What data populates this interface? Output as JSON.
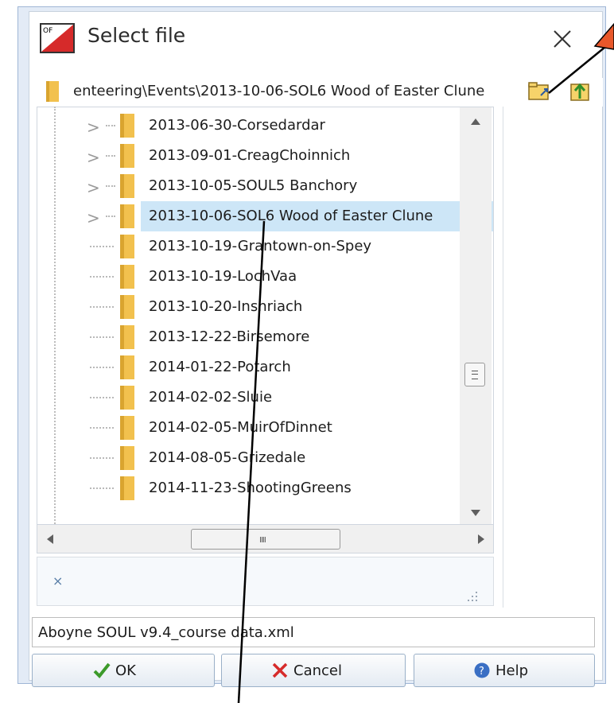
{
  "dialog": {
    "title": "Select file",
    "close_glyph": "✕"
  },
  "pathbar": {
    "path": "enteering\\Events\\2013-10-06-SOL6 Wood of Easter Clune",
    "browse_icon": "open-folder-icon",
    "up_icon": "up-folder-icon"
  },
  "tree": {
    "items": [
      {
        "label": "2013-06-30-Corsedardar",
        "expandable": true
      },
      {
        "label": "2013-09-01-CreagChoinnich",
        "expandable": true
      },
      {
        "label": "2013-10-05-SOUL5 Banchory",
        "expandable": true
      },
      {
        "label": "2013-10-06-SOL6 Wood of Easter Clune",
        "expandable": true,
        "selected": true
      },
      {
        "label": "2013-10-19-Grantown-on-Spey",
        "expandable": false
      },
      {
        "label": "2013-10-19-LochVaa",
        "expandable": false
      },
      {
        "label": "2013-10-20-Inshriach",
        "expandable": false
      },
      {
        "label": "2013-12-22-Birsemore",
        "expandable": false
      },
      {
        "label": "2014-01-22-Potarch",
        "expandable": false
      },
      {
        "label": "2014-02-02-Sluie",
        "expandable": false
      },
      {
        "label": "2014-02-05-MuirOfDinnet",
        "expandable": false
      },
      {
        "label": "2014-08-05-Grizedale",
        "expandable": false
      },
      {
        "label": "2014-11-23-ShootingGreens",
        "expandable": false
      }
    ]
  },
  "scrollbars": {
    "hthumb_grip": "IIII"
  },
  "filter": {
    "clear_glyph": "×"
  },
  "filename": {
    "value": "Aboyne SOUL v9.4_course data.xml"
  },
  "buttons": {
    "ok": "OK",
    "cancel": "Cancel",
    "help": "Help"
  },
  "colors": {
    "selection": "#cde6f7",
    "folder": "#f2c14e",
    "ok_check": "#3c9a2a",
    "cancel_x": "#d62b2b",
    "help_icon": "#3a6fc4"
  }
}
